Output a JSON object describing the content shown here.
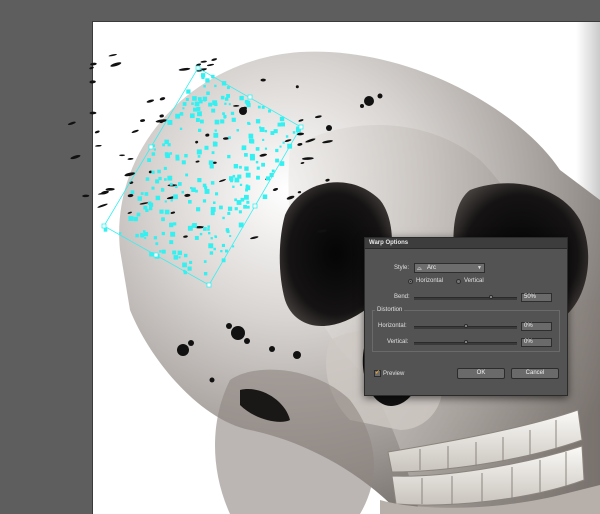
{
  "dialog": {
    "title": "Warp Options",
    "style_label": "Style:",
    "style_value": "Arc",
    "style_icon": "arc-icon",
    "orientation": {
      "horizontal_label": "Horizontal",
      "vertical_label": "Vertical",
      "selected": "Horizontal"
    },
    "bend": {
      "label": "Bend:",
      "value": "50%",
      "level": 0.75
    },
    "distortion": {
      "group_label": "Distortion",
      "horizontal": {
        "label": "Horizontal:",
        "value": "0%",
        "level": 0.5
      },
      "vertical": {
        "label": "Vertical:",
        "value": "0%",
        "level": 0.5
      }
    },
    "preview": {
      "label": "Preview",
      "checked": true
    },
    "ok_label": "OK",
    "cancel_label": "Cancel"
  },
  "colors": {
    "selection": "#35f0f0",
    "pasteboard": "#5e5e5e",
    "artboard": "#ffffff",
    "dialog_bg": "#535353"
  }
}
